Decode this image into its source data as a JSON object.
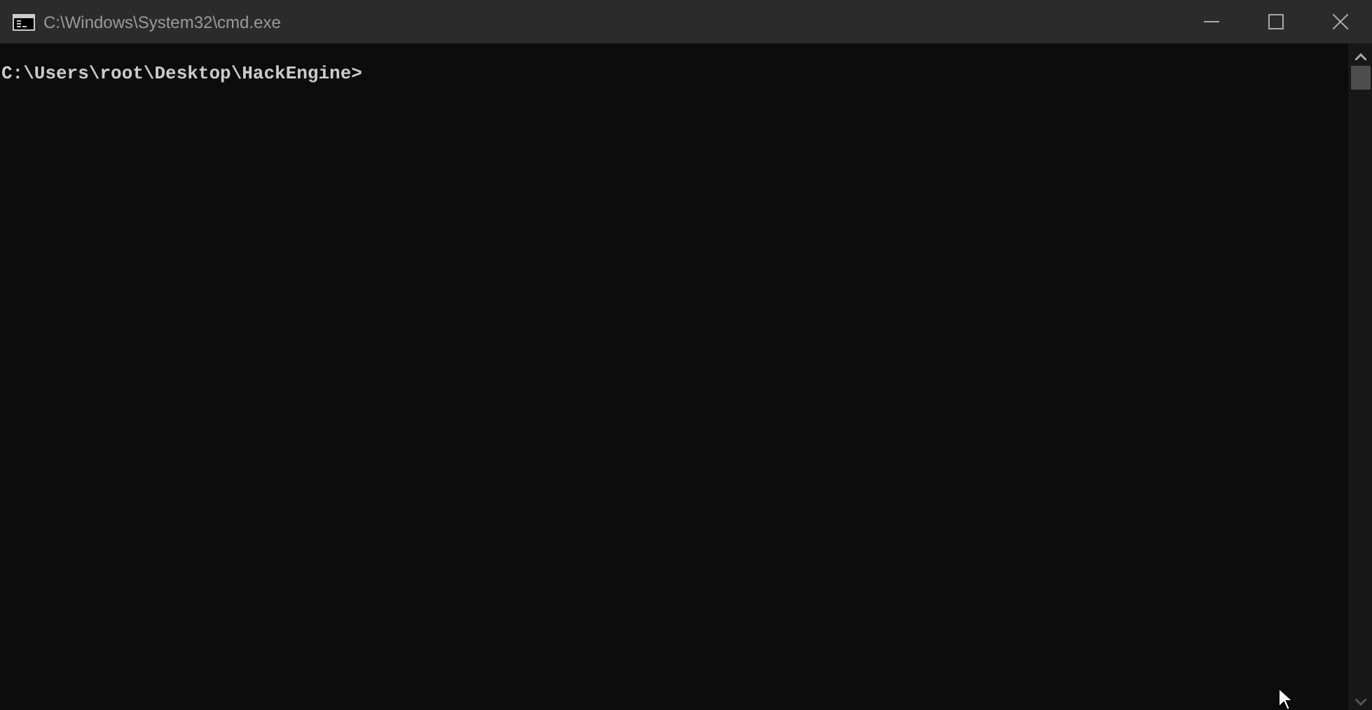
{
  "window": {
    "title": "C:\\Windows\\System32\\cmd.exe"
  },
  "console": {
    "lines": [
      "C:\\Users\\root\\Desktop\\HackEngine>"
    ]
  }
}
